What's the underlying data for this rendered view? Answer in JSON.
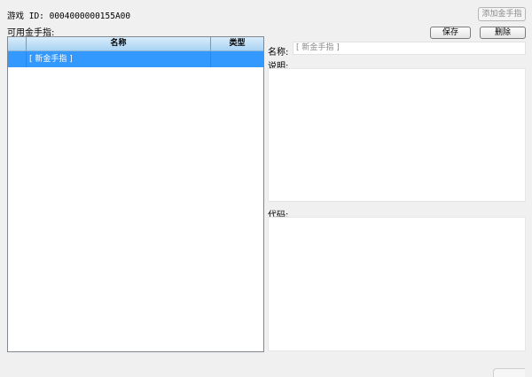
{
  "header": {
    "game_id": "游戏 ID: 0004000000155A00",
    "add_cheat_button": "添加金手指"
  },
  "cheat_list": {
    "label": "可用金手指:",
    "columns": [
      "",
      "名称",
      "类型"
    ],
    "rows": [
      {
        "name": "[ 新金手指 ]",
        "type": "",
        "selected": true
      }
    ]
  },
  "editor": {
    "save_button": "保存",
    "delete_button": "删除",
    "name_label": "名称:",
    "name_value": "[ 新金手指 ]",
    "description_label": "说明:",
    "description_value": "",
    "code_label": "代码:",
    "code_value": ""
  }
}
